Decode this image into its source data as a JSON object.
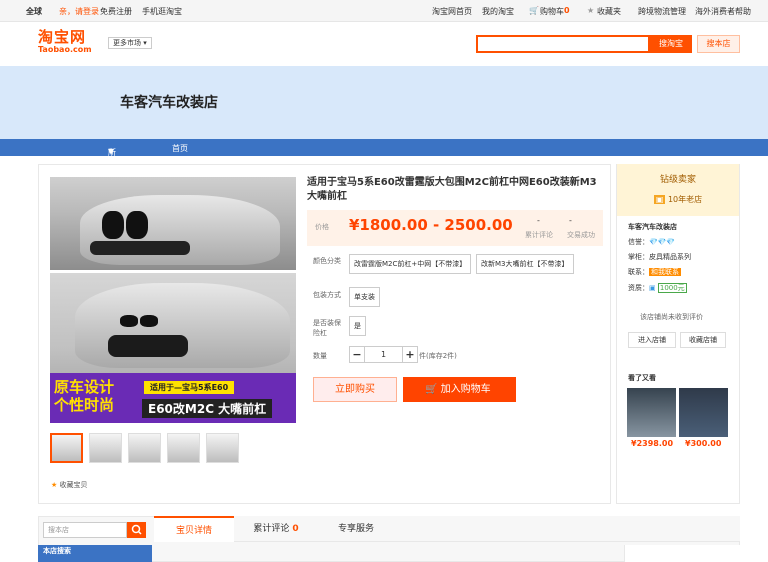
{
  "topbar": {
    "region": "全球",
    "greeting": "亲，请登录",
    "register": "免费注册",
    "mobile": "手机逛淘宝",
    "home": "淘宝网首页",
    "my_taobao": "我的淘宝",
    "cart_label": "购物车",
    "cart_count": "0",
    "favorites": "收藏夹",
    "logistics": "跨境物流管理",
    "help": "海外消费者帮助"
  },
  "header": {
    "logo_cn": "淘宝网",
    "logo_en": "Taobao.com",
    "market_select": "更多市场",
    "search_placeholder": "",
    "search_taobao": "搜淘宝",
    "search_store": "搜本店"
  },
  "banner": {
    "store_name": "车客汽车改装店"
  },
  "nav": {
    "all_categories": "所有分类",
    "home": "首页"
  },
  "product": {
    "title": "适用于宝马5系E60改雷霆版大包围M2C前杠中网E60改装新M3大嘴前杠",
    "price_label": "价格",
    "price": "¥1800.00 - 2500.00",
    "review_value": "-",
    "review_label": "累计评论",
    "sales_value": "-",
    "sales_label": "交易成功",
    "color_label": "颜色分类",
    "color_options": [
      "改雷霆版M2C前杠+中网【不带漆】",
      "改新M3大嘴前杠【不带漆】"
    ],
    "package_label": "包装方式",
    "package_option": "单支装",
    "bumper_label": "是否装保险杠",
    "bumper_option": "是",
    "qty_label": "数量",
    "qty_value": "1",
    "qty_minus": "−",
    "qty_plus": "+",
    "stock": "件(库存2件)",
    "buy_now": "立即购买",
    "add_cart": "加入购物车",
    "favorite": "收藏宝贝",
    "ad_text_1": "原车设计",
    "ad_text_2": "个性时尚",
    "ad_text_3": "适用于—宝马5系E60",
    "ad_text_4": "E60改M2C 大嘴前杠"
  },
  "seller": {
    "level": "钻级卖家",
    "years": "10年老店",
    "shop_name": "车客汽车改装店",
    "credit_label": "信誉：",
    "credit_value": "💎💎💎",
    "main_label": "掌柜：",
    "main_value": "皮具精品系列",
    "contact_label": "联系：",
    "contact_value": "和我联系",
    "quality_label": "资质：",
    "deposit": "1000元",
    "no_reviews": "该店铺尚未收到评价",
    "enter_shop": "进入店铺",
    "fav_shop": "收藏店铺",
    "also_viewed": "看了又看",
    "rec_prices": [
      "¥2398.00",
      "¥300.00"
    ]
  },
  "bottom": {
    "search_placeholder": "搜本店",
    "search_title": "本店搜索",
    "tabs": [
      {
        "label": "宝贝详情"
      },
      {
        "label": "累计评论",
        "count": "0"
      },
      {
        "label": "专享服务"
      }
    ]
  },
  "colors": {
    "brand": "#ff5000",
    "nav": "#3b73c4",
    "banner": "#d8e8fa"
  }
}
